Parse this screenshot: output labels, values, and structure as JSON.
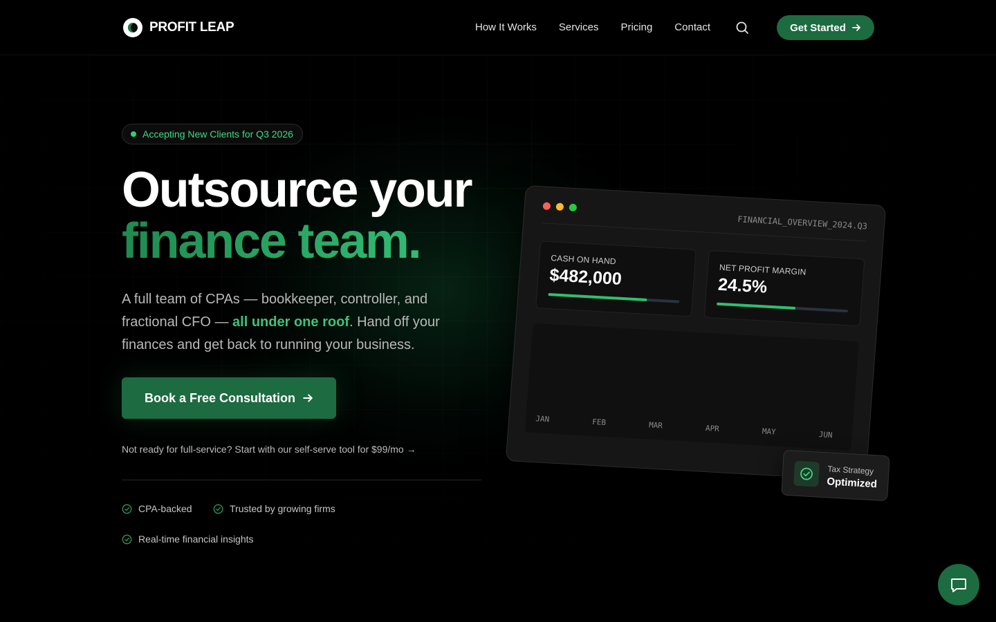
{
  "brand": {
    "name": "PROFIT LEAP"
  },
  "nav": {
    "links": [
      "How It Works",
      "Services",
      "Pricing",
      "Contact"
    ],
    "cta": "Get Started"
  },
  "hero": {
    "badge": "Accepting New Clients for Q3 2026",
    "title_line1": "Outsource your",
    "title_line2": "finance team.",
    "lead_part1": "A full team of CPAs — bookkeeper, controller, and fractional CFO — ",
    "lead_highlight": "all under one roof",
    "lead_part2": ". Hand off your finances and get back to running your business.",
    "cta": "Book a Free Consultation",
    "selfserve": "Not ready for full-service? Start with our self-serve tool for $99/mo →",
    "features": [
      "CPA-backed",
      "Trusted by growing firms",
      "Real-time financial insights"
    ]
  },
  "dashboard": {
    "filename": "FINANCIAL_OVERVIEW_2024.Q3",
    "cards": [
      {
        "label": "CASH ON HAND",
        "value": "$482,000",
        "progress": 0.75
      },
      {
        "label": "NET PROFIT MARGIN",
        "value": "24.5%",
        "progress": 0.6
      }
    ],
    "months": [
      "JAN",
      "FEB",
      "MAR",
      "APR",
      "MAY",
      "JUN"
    ],
    "badge_line1": "Tax Strategy",
    "badge_line2": "Optimized"
  },
  "colors": {
    "accent": "#1d6b40",
    "accent_bright": "#3ddc84",
    "dot_red": "#ff5f57",
    "dot_yellow": "#febc2e",
    "dot_green": "#28c840"
  },
  "icons": {
    "search": "search-icon",
    "arrow": "arrow-right-icon",
    "check": "check-circle-icon",
    "chat": "chat-icon"
  }
}
